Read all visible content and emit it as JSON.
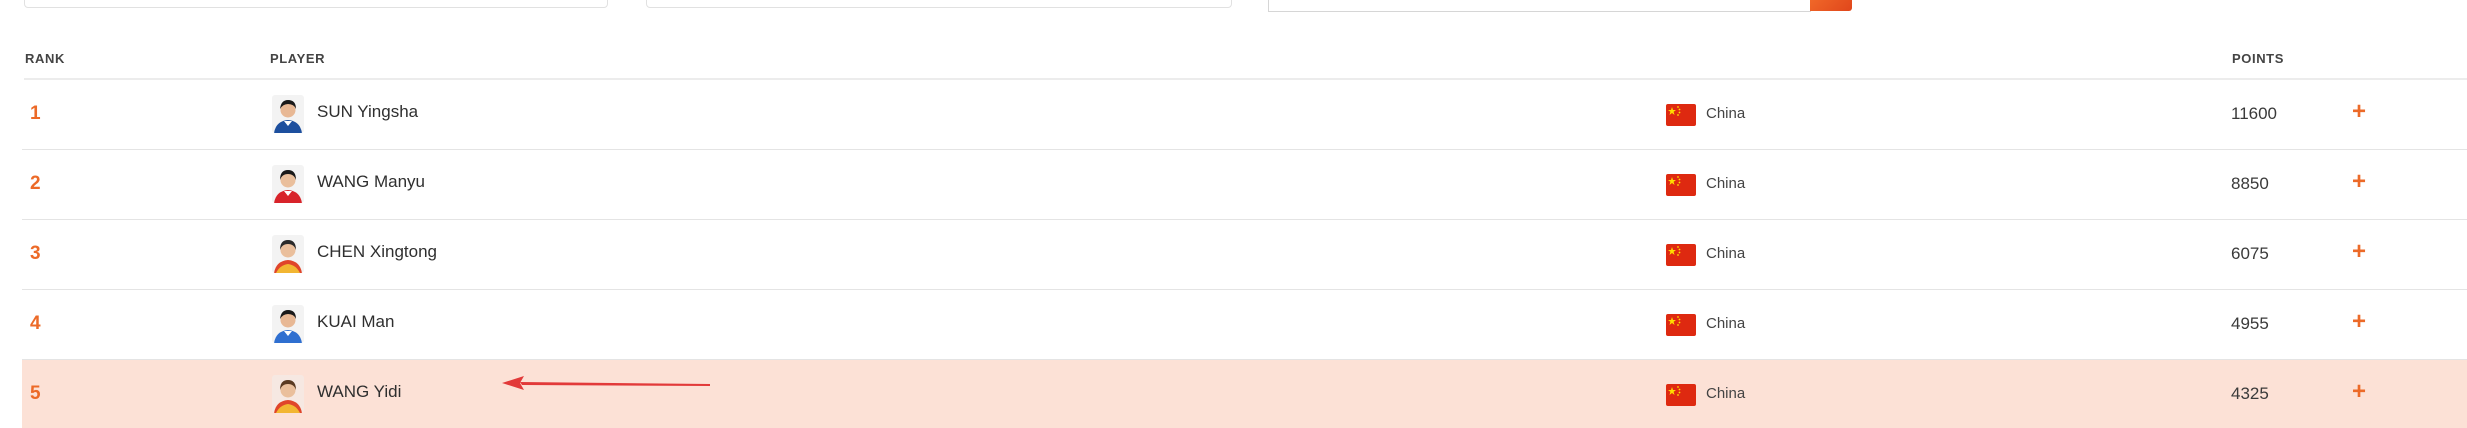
{
  "table": {
    "headers": {
      "rank": "RANK",
      "player": "PLAYER",
      "points": "POINTS"
    },
    "rows": [
      {
        "rank": "1",
        "name": "SUN Yingsha",
        "country": "China",
        "points": "11600",
        "highlighted": false
      },
      {
        "rank": "2",
        "name": "WANG Manyu",
        "country": "China",
        "points": "8850",
        "highlighted": false
      },
      {
        "rank": "3",
        "name": "CHEN Xingtong",
        "country": "China",
        "points": "6075",
        "highlighted": false
      },
      {
        "rank": "4",
        "name": "KUAI Man",
        "country": "China",
        "points": "4955",
        "highlighted": false
      },
      {
        "rank": "5",
        "name": "WANG Yidi",
        "country": "China",
        "points": "4325",
        "highlighted": true
      }
    ],
    "expand_icon": "plus-icon",
    "expand_glyph": "+"
  },
  "colors": {
    "accent": "#ec6a28",
    "highlight_row": "#fce1d6",
    "annotation_arrow": "#e23a3a",
    "flag_red": "#de2910",
    "flag_yellow": "#ffde00"
  }
}
